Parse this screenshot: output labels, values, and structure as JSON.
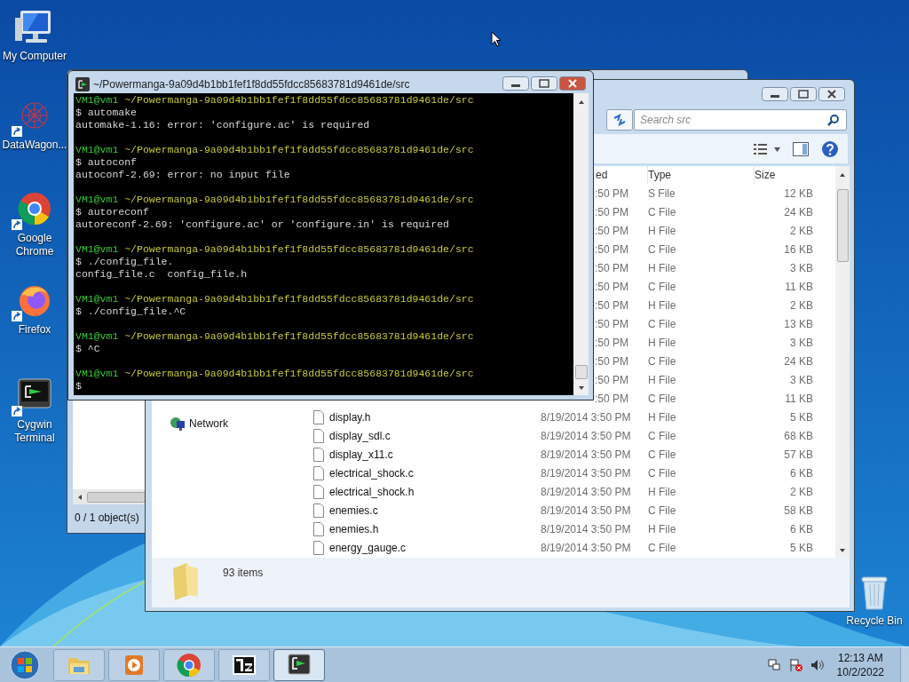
{
  "desktop_icons": [
    {
      "kind": "computer",
      "label": "My Computer",
      "shortcut": false
    },
    {
      "kind": "network",
      "label": "DataWagon...",
      "shortcut": true
    },
    {
      "kind": "chrome",
      "label": "Google Chrome",
      "shortcut": true
    },
    {
      "kind": "firefox",
      "label": "Firefox",
      "shortcut": true
    },
    {
      "kind": "terminal",
      "label": "Cygwin Terminal",
      "shortcut": true
    },
    {
      "kind": "recycle",
      "label": "Recycle Bin",
      "shortcut": false
    }
  ],
  "back_window": {
    "status": "0 / 1 object(s)"
  },
  "explorer": {
    "search": {
      "placeholder": "Search src"
    },
    "columns": [
      "ed",
      "Type",
      "Size"
    ],
    "nav_items": [
      {
        "label": "Network"
      }
    ],
    "rows": [
      {
        "date": ":50 PM",
        "type": "S File",
        "size": "12 KB"
      },
      {
        "date": ":50 PM",
        "type": "C File",
        "size": "24 KB"
      },
      {
        "date": ":50 PM",
        "type": "H File",
        "size": "2 KB"
      },
      {
        "date": ":50 PM",
        "type": "C File",
        "size": "16 KB"
      },
      {
        "date": ":50 PM",
        "type": "H File",
        "size": "3 KB"
      },
      {
        "date": ":50 PM",
        "type": "C File",
        "size": "11 KB"
      },
      {
        "date": ":50 PM",
        "type": "H File",
        "size": "2 KB"
      },
      {
        "date": ":50 PM",
        "type": "C File",
        "size": "13 KB"
      },
      {
        "date": ":50 PM",
        "type": "H File",
        "size": "3 KB"
      },
      {
        "date": ":50 PM",
        "type": "C File",
        "size": "24 KB"
      },
      {
        "date": ":50 PM",
        "type": "H File",
        "size": "3 KB"
      },
      {
        "date": ":50 PM",
        "type": "C File",
        "size": "11 KB"
      },
      {
        "name": "display.h",
        "date": "8/19/2014 3:50 PM",
        "type": "H File",
        "size": "5 KB"
      },
      {
        "name": "display_sdl.c",
        "date": "8/19/2014 3:50 PM",
        "type": "C File",
        "size": "68 KB"
      },
      {
        "name": "display_x11.c",
        "date": "8/19/2014 3:50 PM",
        "type": "C File",
        "size": "57 KB"
      },
      {
        "name": "electrical_shock.c",
        "date": "8/19/2014 3:50 PM",
        "type": "C File",
        "size": "6 KB"
      },
      {
        "name": "electrical_shock.h",
        "date": "8/19/2014 3:50 PM",
        "type": "H File",
        "size": "2 KB"
      },
      {
        "name": "enemies.c",
        "date": "8/19/2014 3:50 PM",
        "type": "C File",
        "size": "58 KB"
      },
      {
        "name": "enemies.h",
        "date": "8/19/2014 3:50 PM",
        "type": "H File",
        "size": "6 KB"
      },
      {
        "name": "energy_gauge.c",
        "date": "8/19/2014 3:50 PM",
        "type": "C File",
        "size": "5 KB"
      }
    ],
    "details": {
      "count": "93 items"
    }
  },
  "terminal": {
    "title": "~/Powermanga-9a09d4b1bb1fef1f8dd55fdcc85683781d9461de/src",
    "blocks": [
      {
        "user": "VM1@vm1",
        "path": "~/Powermanga-9a09d4b1bb1fef1f8dd55fdcc85683781d9461de/src",
        "command": "$ automake",
        "output": "automake-1.16: error: 'configure.ac' is required"
      },
      {
        "user": "VM1@vm1",
        "path": "~/Powermanga-9a09d4b1bb1fef1f8dd55fdcc85683781d9461de/src",
        "command": "$ autoconf",
        "output": "autoconf-2.69: error: no input file"
      },
      {
        "user": "VM1@vm1",
        "path": "~/Powermanga-9a09d4b1bb1fef1f8dd55fdcc85683781d9461de/src",
        "command": "$ autoreconf",
        "output": "autoreconf-2.69: 'configure.ac' or 'configure.in' is required"
      },
      {
        "user": "VM1@vm1",
        "path": "~/Powermanga-9a09d4b1bb1fef1f8dd55fdcc85683781d9461de/src",
        "command": "$ ./config_file.",
        "output": "config_file.c  config_file.h"
      },
      {
        "user": "VM1@vm1",
        "path": "~/Powermanga-9a09d4b1bb1fef1f8dd55fdcc85683781d9461de/src",
        "command": "$ ./config_file.^C"
      },
      {
        "user": "VM1@vm1",
        "path": "~/Powermanga-9a09d4b1bb1fef1f8dd55fdcc85683781d9461de/src",
        "command": "$ ^C"
      },
      {
        "user": "VM1@vm1",
        "path": "~/Powermanga-9a09d4b1bb1fef1f8dd55fdcc85683781d9461de/src",
        "command": "$"
      }
    ]
  },
  "taskbar": {
    "items": [
      {
        "kind": "explorer",
        "active": false
      },
      {
        "kind": "media",
        "active": false
      },
      {
        "kind": "chrome",
        "active": false
      },
      {
        "kind": "sevenzip",
        "active": false
      },
      {
        "kind": "terminal",
        "active": true
      }
    ],
    "time": "12:13 AM",
    "date": "10/2/2022"
  }
}
